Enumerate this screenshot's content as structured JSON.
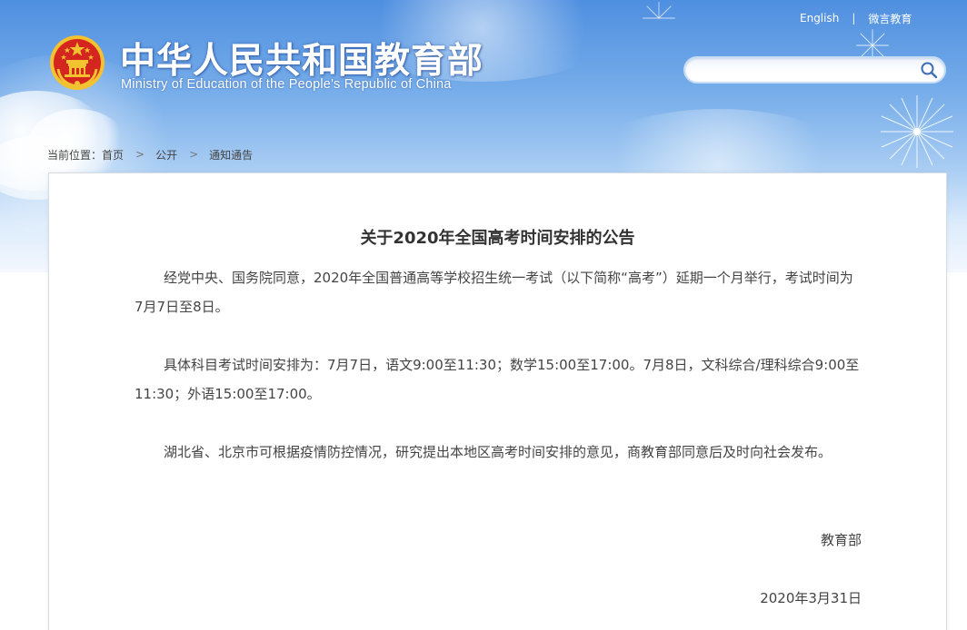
{
  "header": {
    "title_cn": "中华人民共和国教育部",
    "title_en": "Ministry of Education of the People's Republic of China",
    "top_links": [
      {
        "label": "English"
      },
      {
        "label": "微言教育"
      }
    ],
    "search": {
      "value": "",
      "placeholder": ""
    }
  },
  "breadcrumb": {
    "prefix": "当前位置：",
    "items": [
      {
        "label": "首页"
      },
      {
        "label": "公开"
      },
      {
        "label": "通知通告"
      }
    ],
    "separator": ">"
  },
  "article": {
    "title": "关于2020年全国高考时间安排的公告",
    "paragraphs": [
      "经党中央、国务院同意，2020年全国普通高等学校招生统一考试（以下简称“高考”）延期一个月举行，考试时间为7月7日至8日。",
      "具体科目考试时间安排为：7月7日，语文9:00至11:30；数学15:00至17:00。7月8日，文科综合/理科综合9:00至11:30；外语15:00至17:00。",
      "湖北省、北京市可根据疫情防控情况，研究提出本地区高考时间安排的意见，商教育部同意后及时向社会发布。"
    ],
    "signature": "教育部",
    "date": "2020年3月31日"
  },
  "icons": {
    "emblem": "national-emblem-icon",
    "search": "search-icon",
    "chevron": "chevron-right-icon"
  },
  "colors": {
    "banner_top": "#4f8fe0",
    "banner_bottom": "#f4f8fe",
    "emblem_red": "#d4261f",
    "emblem_gold": "#f2c230",
    "text": "#444444"
  }
}
